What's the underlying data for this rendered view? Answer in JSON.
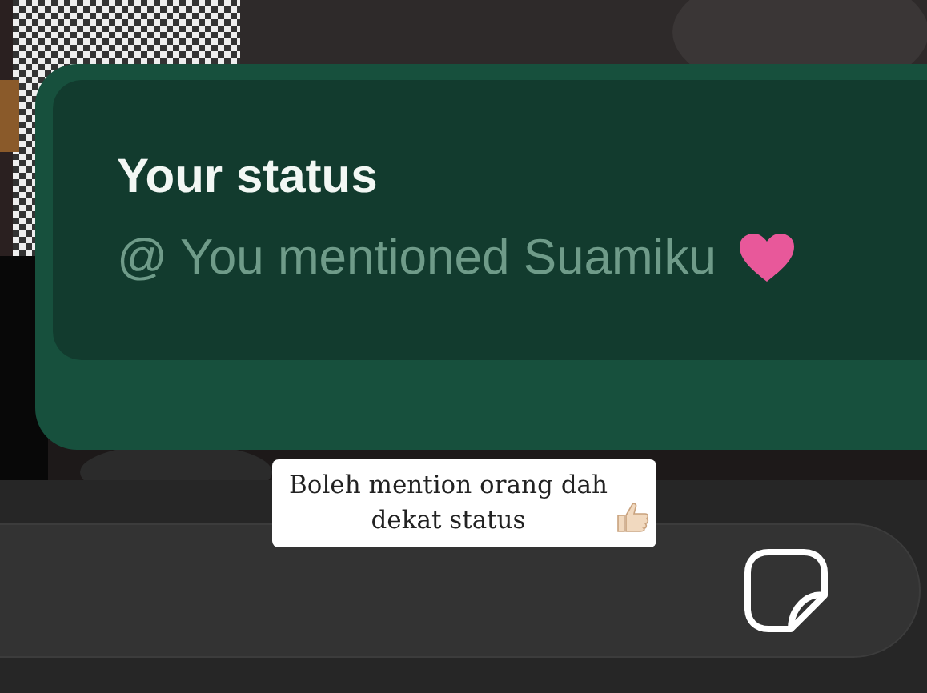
{
  "status_card": {
    "title": "Your status",
    "mention": "@ You mentioned Suamiku"
  },
  "caption": {
    "text": "Boleh mention orang dah dekat status"
  }
}
